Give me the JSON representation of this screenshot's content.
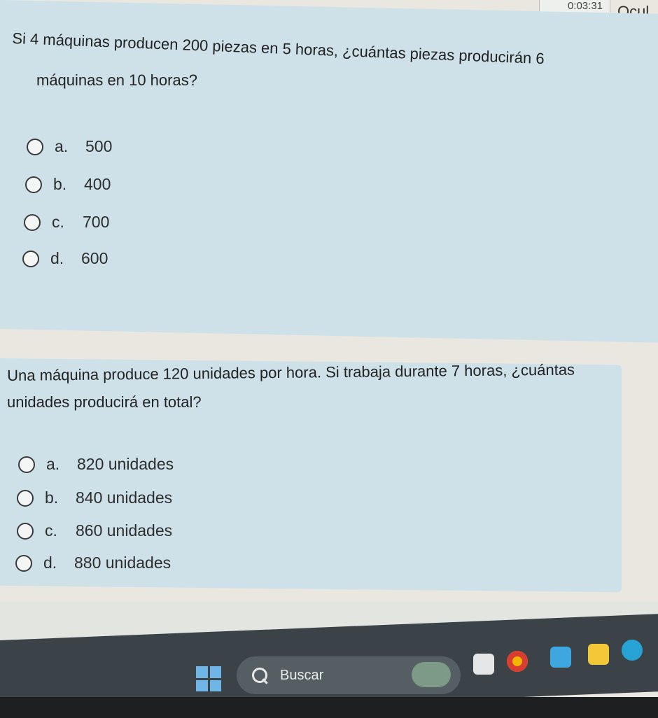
{
  "header": {
    "timer_text": "0:03:31",
    "hide_label": "Ocul"
  },
  "questions": [
    {
      "text_line1": "Si 4 máquinas producen 200 piezas en 5 horas, ¿cuántas piezas producirán 6",
      "text_line2": "máquinas en 10 horas?",
      "options": [
        {
          "letter": "a.",
          "value": "500"
        },
        {
          "letter": "b.",
          "value": "400"
        },
        {
          "letter": "c.",
          "value": "700"
        },
        {
          "letter": "d.",
          "value": "600"
        }
      ]
    },
    {
      "text_line1": "Una máquina produce 120 unidades por hora. Si trabaja durante 7 horas, ¿cuántas",
      "text_line2": "unidades producirá en total?",
      "options": [
        {
          "letter": "a.",
          "value": "820 unidades"
        },
        {
          "letter": "b.",
          "value": "840 unidades"
        },
        {
          "letter": "c.",
          "value": "860 unidades"
        },
        {
          "letter": "d.",
          "value": "880 unidades"
        }
      ]
    }
  ],
  "taskbar": {
    "search_label": "Buscar",
    "start_icon": "windows-start-icon",
    "colors": {
      "bar": "#3b4348",
      "accent": "#6fb6e6"
    }
  }
}
